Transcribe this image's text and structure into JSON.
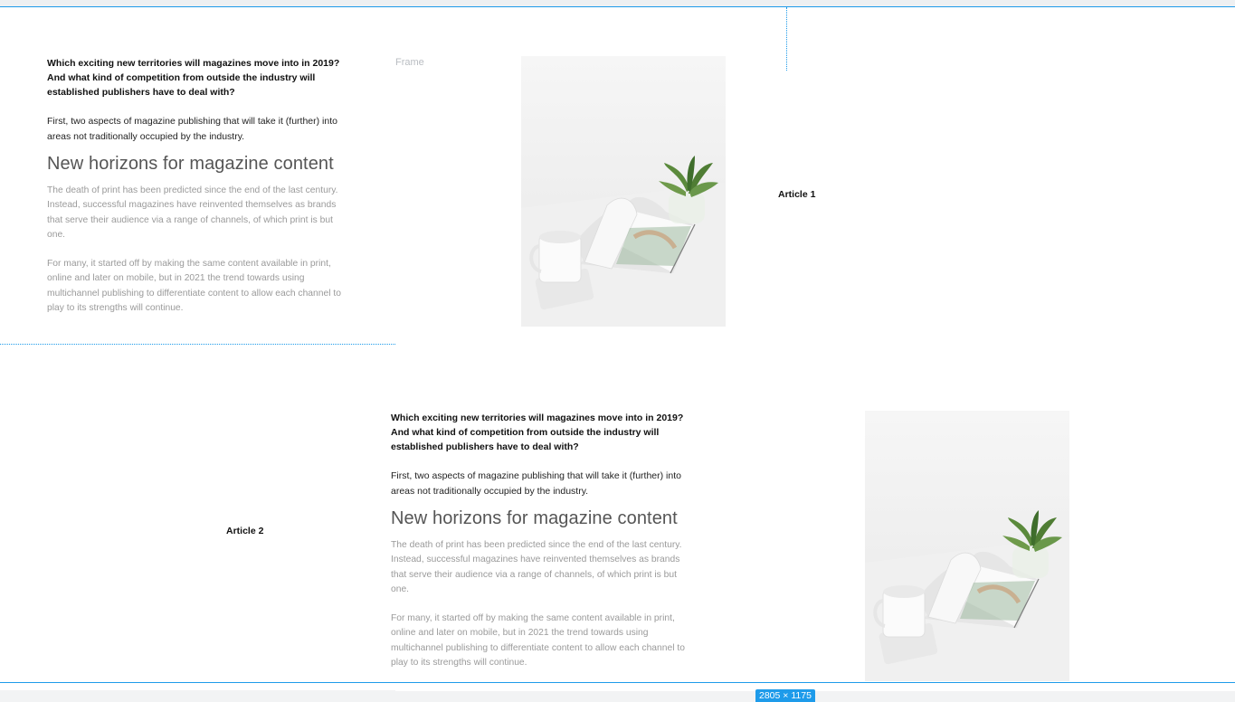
{
  "canvas": {
    "frame_label": "Frame",
    "selection_size": "2805 × 1175",
    "accent_color": "#1e9bea"
  },
  "articles": [
    {
      "title": "Article 1",
      "lead": "Which exciting new territories will magazines move into in 2019? And what kind of competition from outside the industry will established publishers have to deal with?",
      "intro": "First, two aspects of magazine publishing that will take it (further) into areas not traditionally occupied by the industry.",
      "heading": "New horizons for magazine content",
      "paragraphs": [
        "The death of print has been predicted since the end of the last century. Instead, successful magazines have reinvented themselves as brands that serve their audience via a range of channels, of which print is but one.",
        "For many, it started off by making the same content available in print, online and later on mobile, but in 2021 the trend towards using multichannel publishing to differentiate content to allow each channel to play to its strengths will continue."
      ],
      "image_icon": "magazine-mug-plant-photo"
    },
    {
      "title": "Article 2",
      "lead": "Which exciting new territories will magazines move into in 2019? And what kind of competition from outside the industry will established publishers have to deal with?",
      "intro": "First, two aspects of magazine publishing that will take it (further) into areas not traditionally occupied by the industry.",
      "heading": "New horizons for magazine content",
      "paragraphs": [
        "The death of print has been predicted since the end of the last century. Instead, successful magazines have reinvented themselves as brands that serve their audience via a range of channels, of which print is but one.",
        "For many, it started off by making the same content available in print, online and later on mobile, but in 2021 the trend towards using multichannel publishing to differentiate content to allow each channel to play to its strengths will continue."
      ],
      "image_icon": "magazine-mug-plant-photo"
    }
  ]
}
